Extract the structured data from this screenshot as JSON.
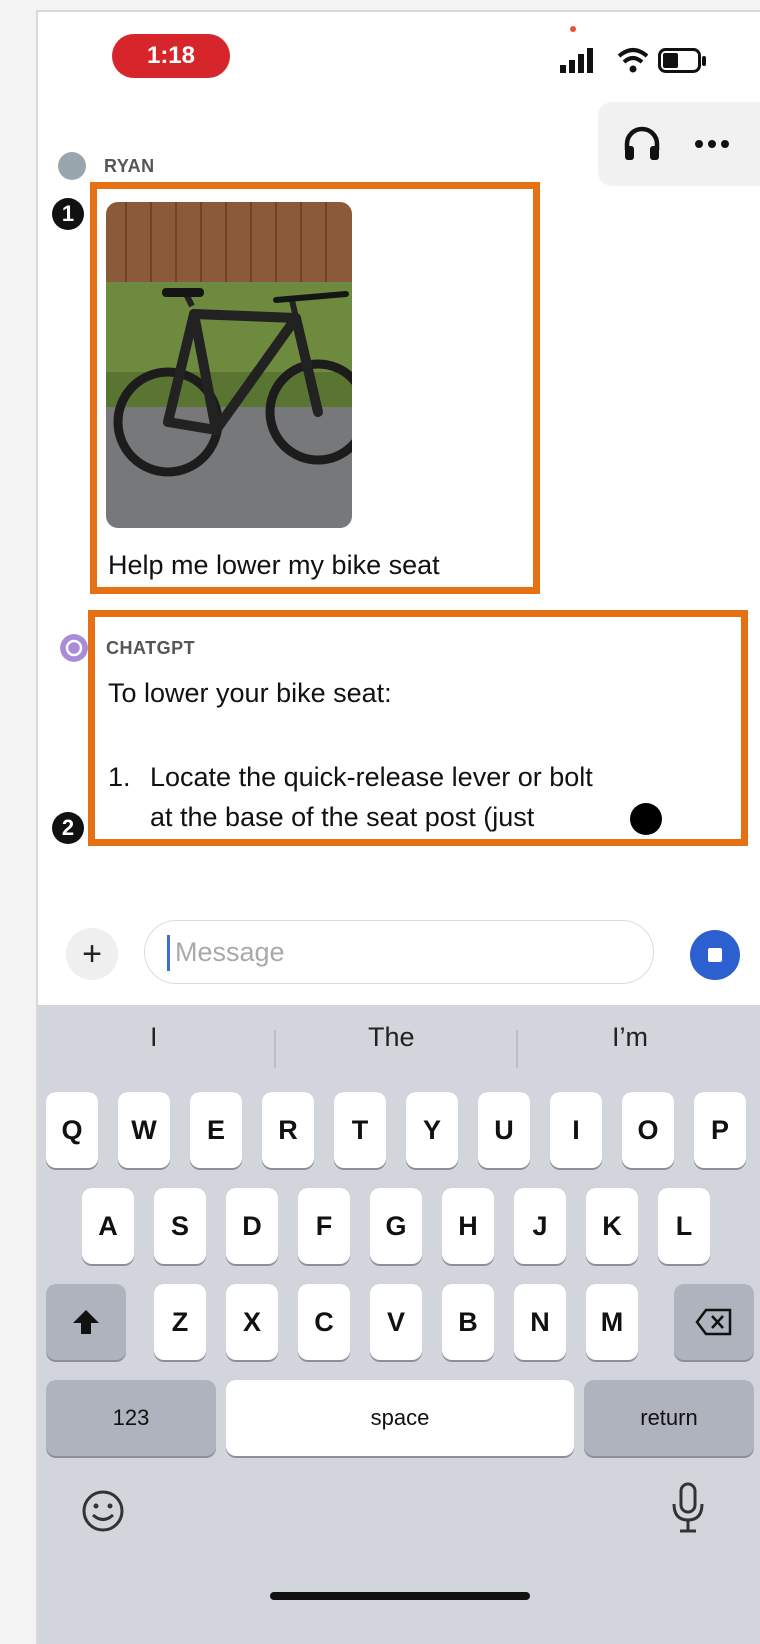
{
  "status_bar": {
    "time": "1:18"
  },
  "header": {
    "headphones_icon": "headphones-icon",
    "more_icon": "more-icon"
  },
  "messages": [
    {
      "sender": "RYAN",
      "text": "Help me lower my bike seat",
      "annotation": "1",
      "image": "bike-photo"
    },
    {
      "sender": "CHATGPT",
      "intro": "To lower your bike seat:",
      "list_number": "1.",
      "list_line1": "Locate the quick-release lever or bolt",
      "list_line2": "at the base of the seat post (just",
      "annotation": "2"
    }
  ],
  "composer": {
    "placeholder": "Message",
    "plus_label": "+"
  },
  "keyboard": {
    "suggestions": [
      "I",
      "The",
      "I’m"
    ],
    "row1": [
      "Q",
      "W",
      "E",
      "R",
      "T",
      "Y",
      "U",
      "I",
      "O",
      "P"
    ],
    "row2": [
      "A",
      "S",
      "D",
      "F",
      "G",
      "H",
      "J",
      "K",
      "L"
    ],
    "row3": [
      "Z",
      "X",
      "C",
      "V",
      "B",
      "N",
      "M"
    ],
    "numbers_label": "123",
    "space_label": "space",
    "return_label": "return"
  },
  "colors": {
    "highlight": "#e57114",
    "record_pill": "#d7262b",
    "send_button": "#2c5fcf"
  }
}
